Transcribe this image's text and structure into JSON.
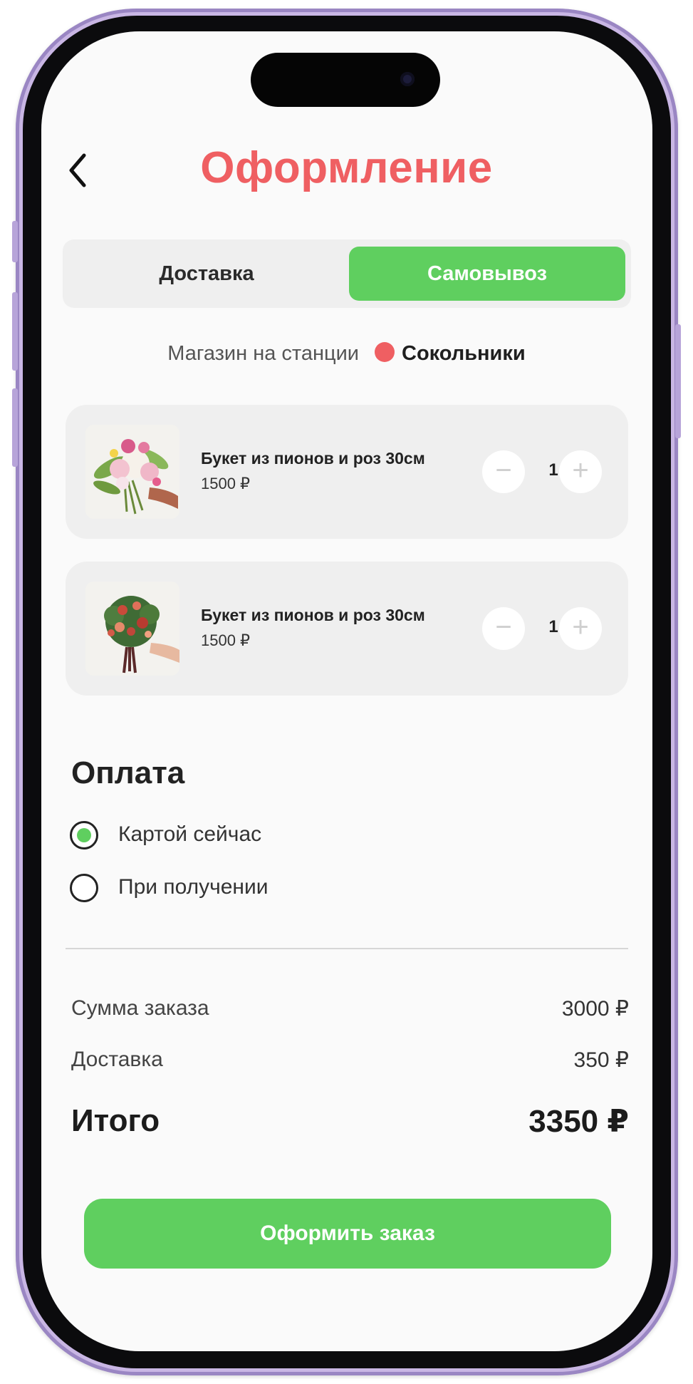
{
  "header": {
    "title": "Оформление",
    "back_icon": "chevron-left-icon"
  },
  "delivery_tabs": [
    {
      "label": "Доставка",
      "selected": false
    },
    {
      "label": "Самовывоз",
      "selected": true
    }
  ],
  "store": {
    "prefix": "Магазин на станции",
    "station": "Сокольники",
    "line_color": "#ef5f62"
  },
  "cart": [
    {
      "name": "Букет из пионов и роз 30см",
      "price": "1500 ₽",
      "quantity": "1",
      "image": "peony-rose-bouquet-photo"
    },
    {
      "name": "Букет из пионов и роз 30см",
      "price": "1500 ₽",
      "quantity": "1",
      "image": "red-rose-bouquet-photo"
    }
  ],
  "payment": {
    "title": "Оплата",
    "options": [
      {
        "label": "Картой сейчас",
        "selected": true
      },
      {
        "label": "При  получении",
        "selected": false
      }
    ]
  },
  "summary": {
    "order_sum_label": "Сумма заказа",
    "order_sum_value": "3000 ₽",
    "delivery_label": "Доставка",
    "delivery_value": "350 ₽",
    "total_label": "Итого",
    "total_value": "3350 ₽"
  },
  "cta": {
    "label": "Оформить заказ"
  },
  "colors": {
    "accent_green": "#5fcf5f",
    "accent_red": "#ef5f62"
  }
}
